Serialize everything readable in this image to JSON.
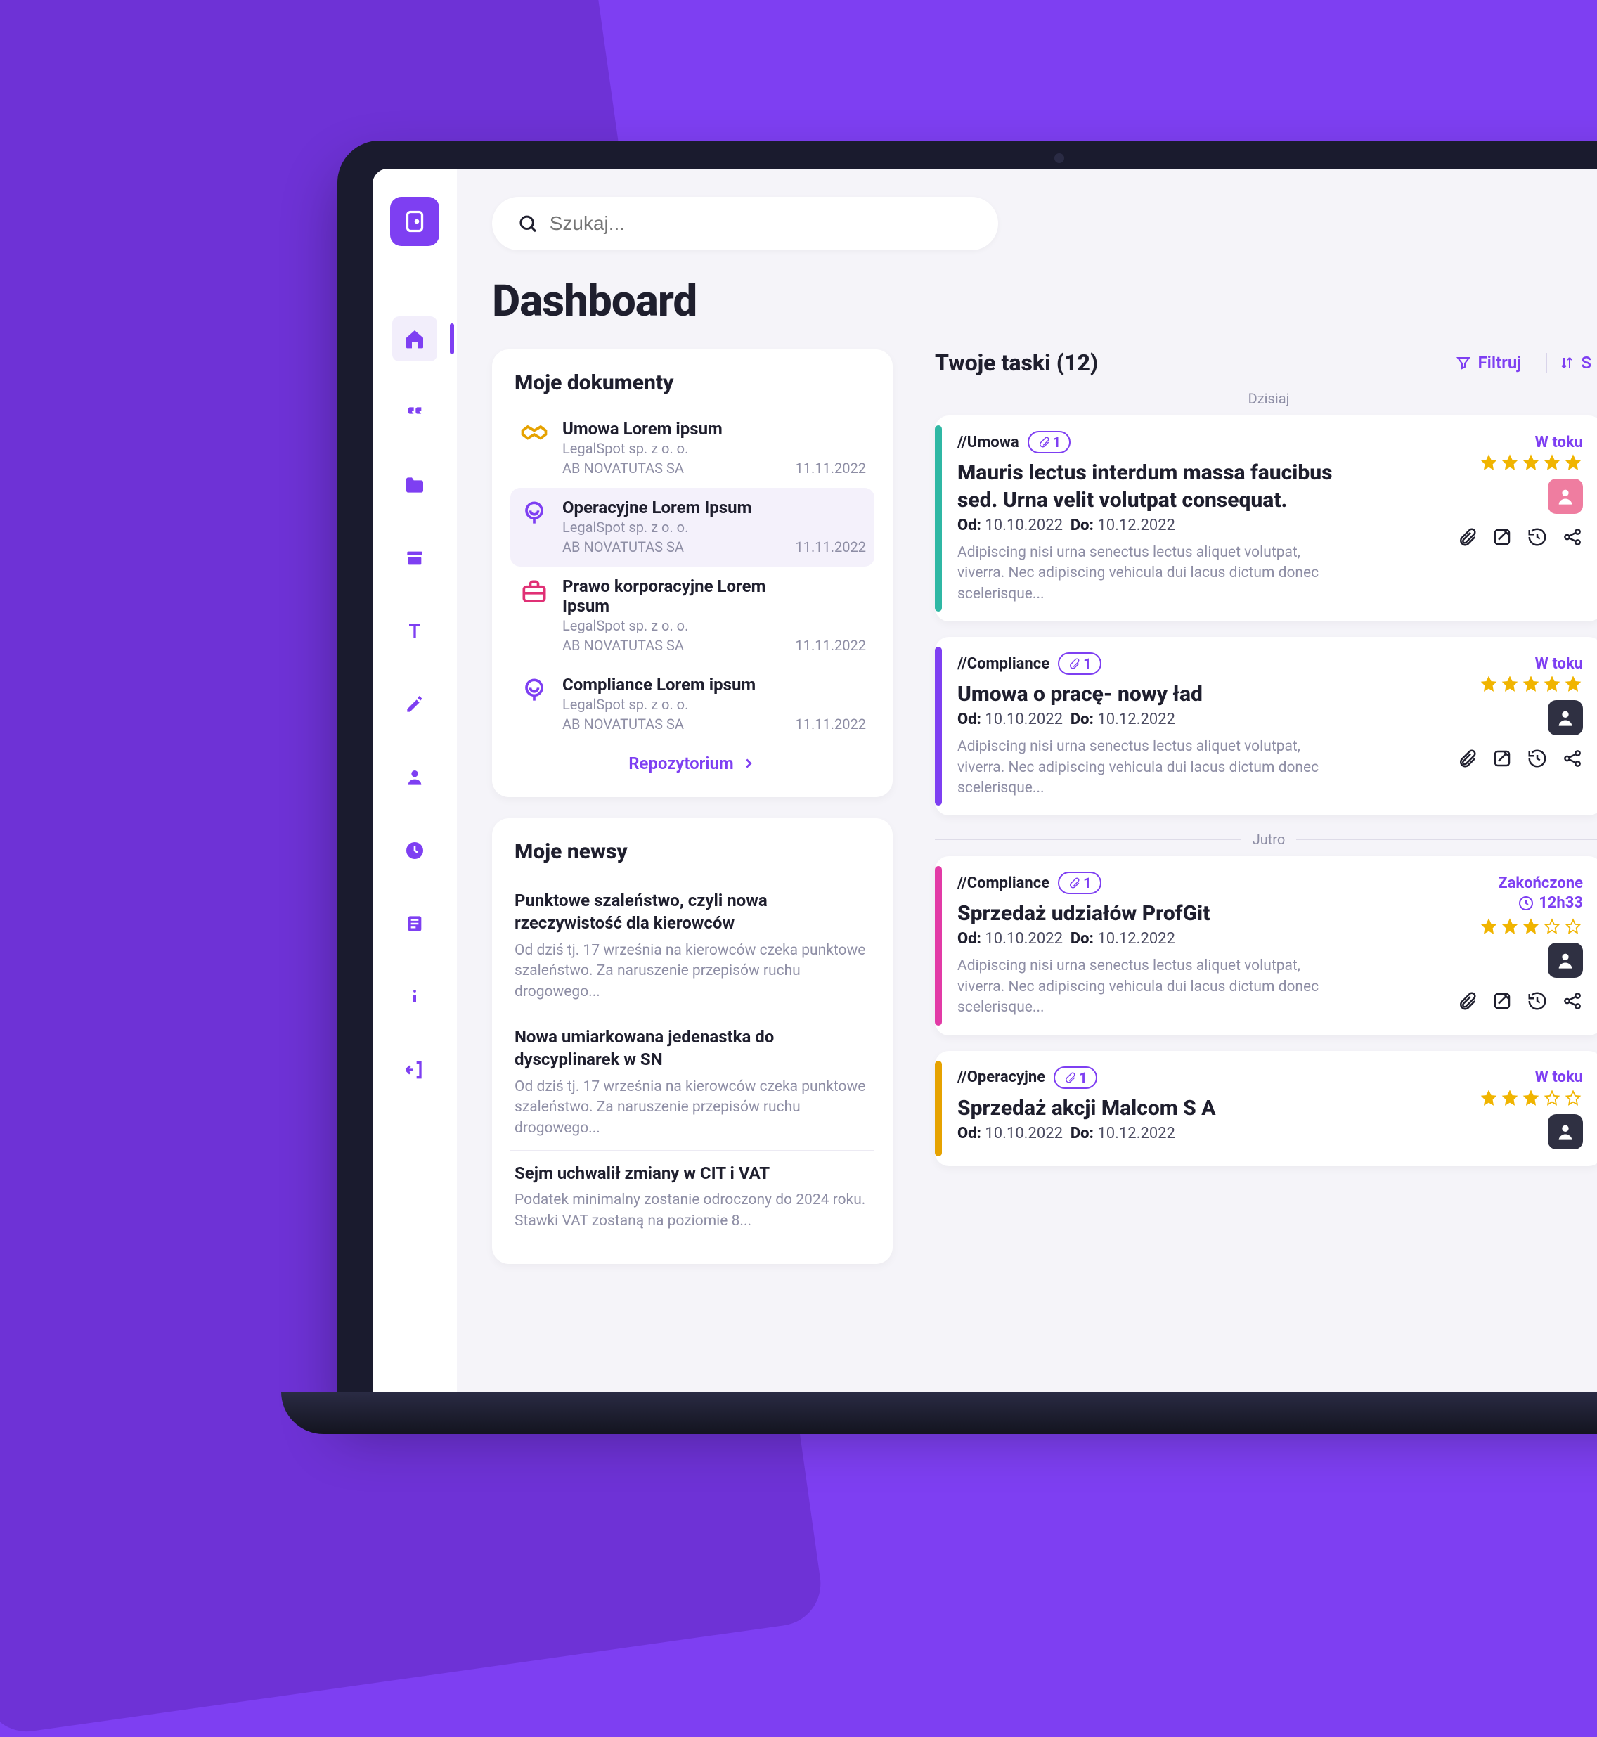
{
  "colors": {
    "purple": "#7e3ff2",
    "teal": "#2fb7a4",
    "magenta": "#e23aa6",
    "gold": "#e6a200"
  },
  "search": {
    "placeholder": "Szukaj..."
  },
  "page_title": "Dashboard",
  "sidebar": {
    "items": [
      {
        "name": "home",
        "active": true
      },
      {
        "name": "quote"
      },
      {
        "name": "folder"
      },
      {
        "name": "archive"
      },
      {
        "name": "text"
      },
      {
        "name": "edit"
      },
      {
        "name": "user"
      },
      {
        "name": "clock"
      },
      {
        "name": "list"
      },
      {
        "name": "info"
      },
      {
        "name": "logout"
      }
    ]
  },
  "documents": {
    "title": "Moje dokumenty",
    "repo_label": "Repozytorium",
    "items": [
      {
        "title": "Umowa Lorem ipsum",
        "org": "LegalSpot sp. z o. o.",
        "org2": "AB NOVATUTAS SA",
        "date": "11.11.2022",
        "icon": "handshake",
        "color": "#e6a200"
      },
      {
        "title": "Operacyjne Lorem Ipsum",
        "org": "LegalSpot sp. z o. o.",
        "org2": "AB NOVATUTAS SA",
        "date": "11.11.2022",
        "icon": "head",
        "color": "#7e3ff2",
        "selected": true
      },
      {
        "title": "Prawo korporacyjne Lorem Ipsum",
        "org": "LegalSpot sp. z o. o.",
        "org2": "AB NOVATUTAS SA",
        "date": "11.11.2022",
        "icon": "briefcase",
        "color": "#e03075"
      },
      {
        "title": "Compliance Lorem ipsum",
        "org": "LegalSpot sp. z o. o.",
        "org2": "AB NOVATUTAS SA",
        "date": "11.11.2022",
        "icon": "head",
        "color": "#7e3ff2"
      }
    ]
  },
  "news": {
    "title": "Moje newsy",
    "items": [
      {
        "title": "Punktowe szaleństwo, czyli nowa rzeczywistość dla kierowców",
        "body": "Od dziś tj. 17 września na kierowców czeka punktowe szaleństwo. Za naruszenie przepisów ruchu drogowego..."
      },
      {
        "title": "Nowa umiarkowana jedenastka do dyscyplinarek w SN",
        "body": "Od dziś tj. 17 września na kierowców czeka punktowe szaleństwo. Za naruszenie przepisów ruchu drogowego..."
      },
      {
        "title": "Sejm uchwalił zmiany w CIT i VAT",
        "body": "Podatek minimalny zostanie odroczony do 2024 roku. Stawki VAT zostaną na poziomie 8..."
      }
    ]
  },
  "tasks": {
    "title": "Twoje taski (12)",
    "filter_label": "Filtruj",
    "sort_label": "S",
    "status_labels": {
      "in_progress": "W toku",
      "done": "Zakończone"
    },
    "attachment_count_label": "1",
    "od_label": "Od:",
    "do_label": "Do:",
    "groups": [
      {
        "label": "Dzisiaj",
        "tasks": [
          {
            "category": "//Umowa",
            "title": "Mauris lectus interdum massa faucibus sed. Urna velit volutpat consequat.",
            "from": "10.10.2022",
            "to": "10.12.2022",
            "desc": "Adipiscing nisi urna senectus lectus aliquet volutpat, viverra. Nec adipiscing vehicula dui lacus dictum donec scelerisque...",
            "status": "in_progress",
            "stars": 5,
            "accent": "#2fb7a4",
            "avatar": "pink",
            "tools": true
          },
          {
            "category": "//Compliance",
            "title": "Umowa o pracę- nowy ład",
            "from": "10.10.2022",
            "to": "10.12.2022",
            "desc": "Adipiscing nisi urna senectus lectus aliquet volutpat, viverra. Nec adipiscing vehicula dui lacus dictum donec scelerisque...",
            "status": "in_progress",
            "stars": 5,
            "accent": "#7e3ff2",
            "avatar": "dark",
            "tools": true
          }
        ]
      },
      {
        "label": "Jutro",
        "tasks": [
          {
            "category": "//Compliance",
            "title": "Sprzedaż udziałów ProfGit",
            "from": "10.10.2022",
            "to": "10.12.2022",
            "desc": "Adipiscing nisi urna senectus lectus aliquet volutpat, viverra. Nec adipiscing vehicula dui lacus dictum donec scelerisque...",
            "status": "done",
            "stars": 3,
            "accent": "#e23aa6",
            "avatar": "dark",
            "tools": true,
            "timer": "12h33"
          },
          {
            "category": "//Operacyjne",
            "title": "Sprzedaż akcji Malcom S A",
            "from": "10.10.2022",
            "to": "10.12.2022",
            "desc": "",
            "status": "in_progress",
            "stars": 3,
            "accent": "#e6a200",
            "avatar": "dark",
            "tools": false
          }
        ]
      }
    ]
  }
}
